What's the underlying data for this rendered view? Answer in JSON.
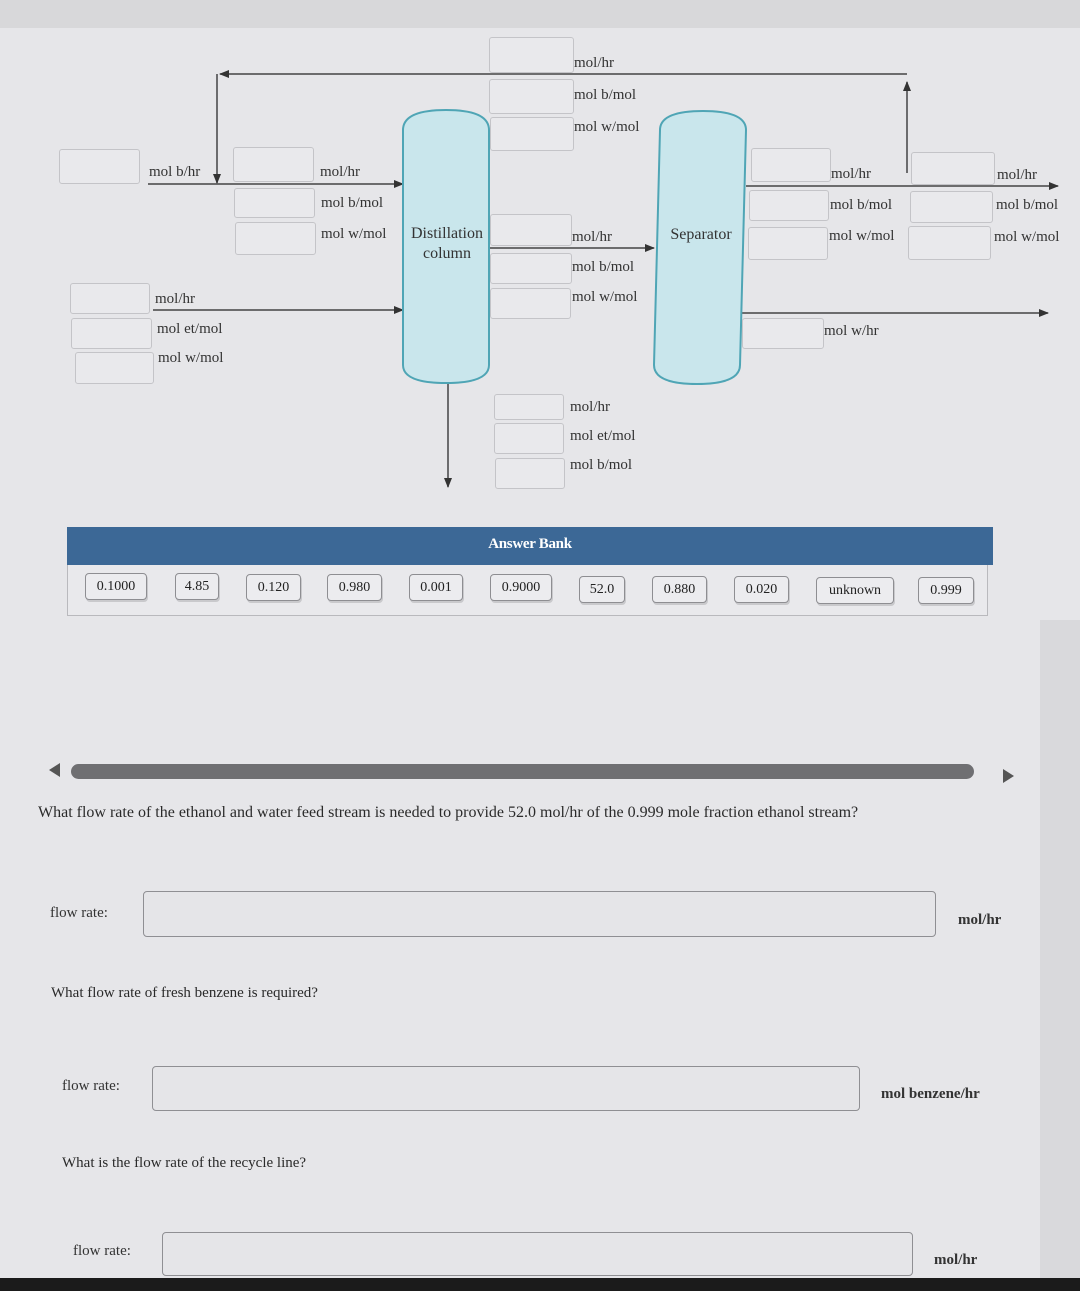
{
  "diagram": {
    "vessels": {
      "distillation": "Distillation column",
      "distillation_line1": "Distillation",
      "distillation_line2": "column",
      "separator": "Separator"
    },
    "streams": {
      "fresh_benzene": {
        "units": [
          "mol b/hr"
        ]
      },
      "column_top_feed": {
        "units": [
          "mol/hr",
          "mol b/mol",
          "mol w/mol"
        ]
      },
      "ethanol_water_feed": {
        "units": [
          "mol/hr",
          "mol et/mol",
          "mol w/mol"
        ]
      },
      "recycle": {
        "units": [
          "mol/hr",
          "mol b/mol",
          "mol w/mol"
        ]
      },
      "column_overhead": {
        "units": [
          "mol/hr",
          "mol b/mol",
          "mol w/mol"
        ]
      },
      "column_bottoms": {
        "units": [
          "mol/hr",
          "mol et/mol",
          "mol b/mol"
        ]
      },
      "separator_top": {
        "units": [
          "mol/hr",
          "mol b/mol",
          "mol w/mol"
        ]
      },
      "purge": {
        "units": [
          "mol/hr",
          "mol b/mol",
          "mol w/mol"
        ]
      },
      "separator_water": {
        "units": [
          "mol w/hr"
        ]
      }
    }
  },
  "answer_bank": {
    "title": "Answer Bank",
    "items": [
      "0.1000",
      "4.85",
      "0.120",
      "0.980",
      "0.001",
      "0.9000",
      "52.0",
      "0.880",
      "0.020",
      "unknown",
      "0.999"
    ]
  },
  "questions": [
    {
      "text": "What flow rate of the ethanol and water feed stream is needed to provide 52.0 mol/hr of the 0.999 mole fraction ethanol stream?",
      "field_label": "flow rate:",
      "value": "",
      "unit": "mol/hr"
    },
    {
      "text": "What flow rate of fresh benzene is required?",
      "field_label": "flow rate:",
      "value": "",
      "unit": "mol benzene/hr"
    },
    {
      "text": "What is the flow rate of the recycle line?",
      "field_label": "flow rate:",
      "value": "",
      "unit": "mol/hr"
    }
  ],
  "colors": {
    "vessel_fill": "#c9e6ec",
    "vessel_stroke": "#4fa5b5",
    "bank_header": "#3c6896"
  }
}
